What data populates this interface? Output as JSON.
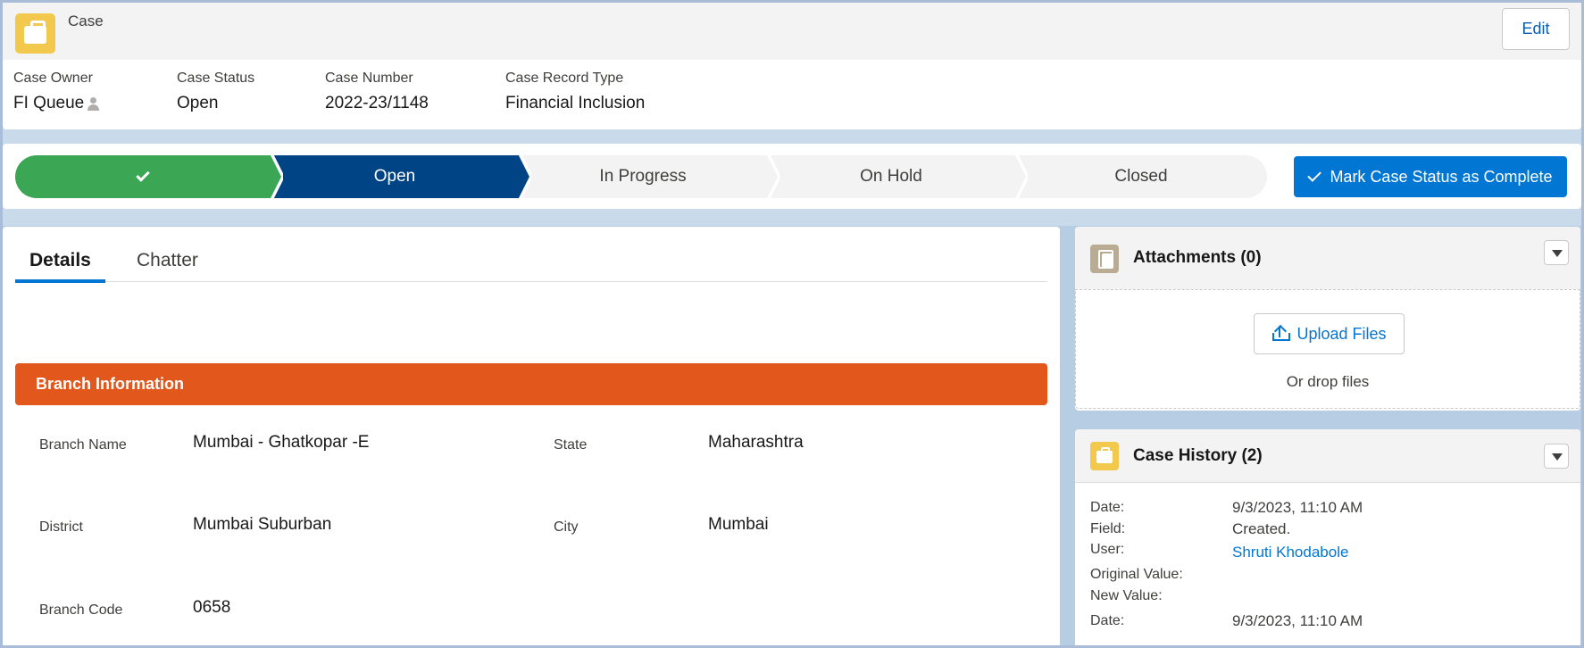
{
  "header": {
    "object_label": "Case",
    "edit_label": "Edit",
    "highlights": [
      {
        "label": "Case Owner",
        "value": "FI Queue"
      },
      {
        "label": "Case Status",
        "value": "Open"
      },
      {
        "label": "Case Number",
        "value": "2022-23/1148"
      },
      {
        "label": "Case Record Type",
        "value": "Financial Inclusion"
      }
    ]
  },
  "path": {
    "steps": [
      {
        "label": "",
        "state": "completed"
      },
      {
        "label": "Open",
        "state": "current"
      },
      {
        "label": "In Progress",
        "state": "incomplete"
      },
      {
        "label": "On Hold",
        "state": "incomplete"
      },
      {
        "label": "Closed",
        "state": "incomplete"
      }
    ],
    "complete_button_label": "Mark Case Status as Complete"
  },
  "details": {
    "tabs": [
      "Details",
      "Chatter"
    ],
    "section_title": "Branch Information",
    "fields": [
      {
        "label": "Branch Name",
        "value": "Mumbai - Ghatkopar -E"
      },
      {
        "label": "State",
        "value": "Maharashtra"
      },
      {
        "label": "District",
        "value": "Mumbai Suburban"
      },
      {
        "label": "City",
        "value": "Mumbai"
      },
      {
        "label": "Branch Code",
        "value": "0658"
      }
    ]
  },
  "attachments": {
    "title": "Attachments (0)",
    "upload_label": "Upload Files",
    "drop_text": "Or drop files"
  },
  "history": {
    "title": "Case History (2)",
    "labels": {
      "date": "Date:",
      "field": "Field:",
      "user": "User:",
      "original": "Original Value:",
      "new": "New Value:"
    },
    "entries": [
      {
        "date": "9/3/2023, 11:10 AM",
        "field": "Created.",
        "user": "Shruti Khodabole"
      },
      {
        "date": "9/3/2023, 11:10 AM"
      }
    ]
  },
  "colors": {
    "brand_blue": "#0176d3",
    "path_current": "#014486",
    "path_completed": "#3ba755",
    "section_orange": "#e2581c",
    "case_icon": "#f2c94c"
  }
}
